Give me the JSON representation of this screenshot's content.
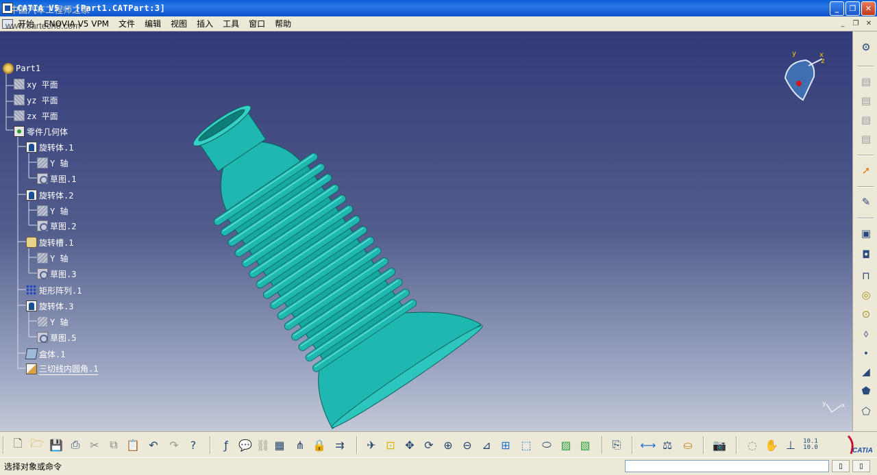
{
  "window": {
    "title": "CATIA V5 - [Part1.CATPart:3]",
    "watermark": "中国汽车工程师之家",
    "minimize": "_",
    "restore": "❐",
    "close": "✕"
  },
  "menubar": {
    "site_watermark": "www.cartech8.com",
    "items": [
      "开始",
      "ENOVIA V5 VPM",
      "文件",
      "编辑",
      "视图",
      "插入",
      "工具",
      "窗口",
      "帮助"
    ],
    "doc_controls": [
      "_",
      "❐",
      "✕"
    ]
  },
  "tree": {
    "items": [
      {
        "label": "Part1",
        "icon": "part-icon"
      },
      {
        "label": "xy 平面",
        "icon": "plane-icon"
      },
      {
        "label": "yz 平面",
        "icon": "plane-icon"
      },
      {
        "label": "zx 平面",
        "icon": "plane-icon"
      },
      {
        "label": "零件几何体",
        "icon": "body-icon"
      },
      {
        "label": "旋转体.1",
        "icon": "revolve-icon"
      },
      {
        "label": "Y 轴",
        "icon": "axis-icon"
      },
      {
        "label": "草图.1",
        "icon": "sketch-icon"
      },
      {
        "label": "旋转体.2",
        "icon": "revolve-icon"
      },
      {
        "label": "Y 轴",
        "icon": "axis-icon"
      },
      {
        "label": "草图.2",
        "icon": "sketch-icon"
      },
      {
        "label": "旋转槽.1",
        "icon": "groove-icon"
      },
      {
        "label": "Y 轴",
        "icon": "axis-icon"
      },
      {
        "label": "草图.3",
        "icon": "sketch-icon"
      },
      {
        "label": "矩形阵列.1",
        "icon": "pattern-icon"
      },
      {
        "label": "旋转体.3",
        "icon": "revolve-icon"
      },
      {
        "label": "Y 轴",
        "icon": "axis-icon"
      },
      {
        "label": "草图.5",
        "icon": "sketch-icon"
      },
      {
        "label": "盒体.1",
        "icon": "shell-icon"
      },
      {
        "label": "三切线内圆角.1",
        "icon": "fillet-icon"
      }
    ]
  },
  "compass": {
    "y": "y",
    "x": "x",
    "z": "z"
  },
  "model": {
    "color": "#1fb8b0",
    "edge_color": "#0d5f5a",
    "rib_count": 15
  },
  "viewport_axis": {
    "y": "y",
    "x": "x"
  },
  "right_toolbar": {
    "icons": [
      "settings-icon",
      "view-icon",
      "view2-icon",
      "view3-icon",
      "view4-icon",
      "select-arrow-icon",
      "sketcher-icon",
      "pad-icon",
      "pocket-icon",
      "shaft-icon",
      "groove-icon",
      "hole-icon",
      "rib-icon",
      "slot-icon",
      "stiffener-icon",
      "loft-icon",
      "remove-loft-icon"
    ]
  },
  "bottom_toolbar": {
    "icons": [
      "new-icon",
      "open-icon",
      "save-icon",
      "print-icon",
      "cut-icon",
      "copy-icon",
      "paste-icon",
      "undo-icon",
      "redo-icon",
      "whats-this-icon",
      "formula-icon",
      "comment-icon",
      "link-icon",
      "table-icon",
      "tree-icon",
      "lock-icon",
      "publish-icon",
      "fly-icon",
      "fit-all-icon",
      "pan-icon",
      "rotate-icon",
      "zoom-in-icon",
      "zoom-out-icon",
      "normal-view-icon",
      "multi-view-icon",
      "iso-view-icon",
      "shading-icon",
      "hide-show-icon",
      "swap-icon",
      "catalog-icon",
      "measure-icon",
      "measure-item-icon",
      "inertia-icon",
      "capture-icon",
      "orbit-icon",
      "hand-icon",
      "axis-system-icon",
      "scale-icon"
    ],
    "scale_text": "10.1 10.0",
    "logo": "CATIA"
  },
  "statusbar": {
    "prompt": "选择对象或命令",
    "command_value": ""
  }
}
